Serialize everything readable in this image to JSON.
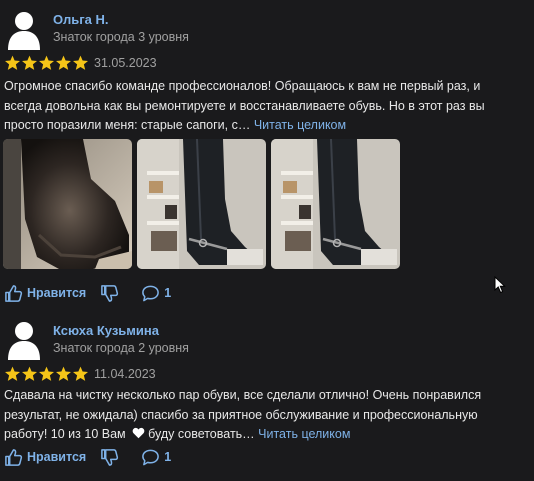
{
  "reviews": [
    {
      "author": "Ольга Н.",
      "level": "Знаток города 3 уровня",
      "rating": 5,
      "date": "31.05.2023",
      "text_lines": [
        "Огромное спасибо команде профессионалов! Обращаюсь к вам не первый раз, и",
        "всегда довольна как вы ремонтируете и восстанавливаете обувь. Но в этот раз вы",
        "просто поразили меня: старые сапоги, с… "
      ],
      "read_more": "Читать целиком",
      "photos": [
        "old-boot-photo",
        "new-boot-photo",
        "new-boot-photo-2"
      ],
      "like_label": "Нравится",
      "comment_count": "1"
    },
    {
      "author": "Ксюха Кузьмина",
      "level": "Знаток города 2 уровня",
      "rating": 5,
      "date": "11.04.2023",
      "text_lines": [
        "Сдавала на чистку несколько пар обуви, все сделали отлично! Очень понравился",
        "результат, не ожидала) спасибо за приятное обслуживание и профессиональную",
        "работу! 10 из 10 Вам",
        "буду советовать… "
      ],
      "read_more": "Читать целиком",
      "like_label": "Нравится",
      "comment_count": "1"
    }
  ],
  "colors": {
    "background": "#1a1a1c",
    "link": "#7fb2e8",
    "star": "#f5c518",
    "muted": "#a0a0a0"
  }
}
